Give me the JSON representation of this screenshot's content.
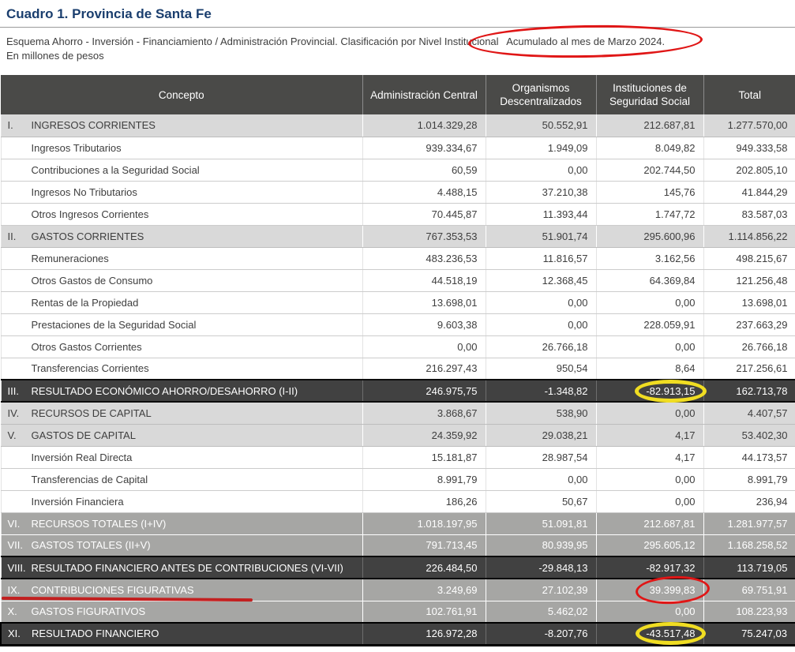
{
  "page": {
    "title": "Cuadro 1. Provincia de Santa Fe",
    "subtitle": "Esquema Ahorro - Inversión - Financiamiento / Administración Provincial. Clasificación por Nivel Institucional",
    "period": "Acumulado al mes de Marzo 2024.",
    "units": "En millones de pesos"
  },
  "table": {
    "headers": [
      "Concepto",
      "Administración Central",
      "Organismos Descentralizados",
      "Instituciones de Seguridad Social",
      "Total"
    ],
    "rows": [
      {
        "numeral": "I.",
        "label": "INGRESOS CORRIENTES",
        "style": "section",
        "values": [
          "1.014.329,28",
          "50.552,91",
          "212.687,81",
          "1.277.570,00"
        ]
      },
      {
        "numeral": "",
        "label": "Ingresos Tributarios",
        "style": "detail",
        "values": [
          "939.334,67",
          "1.949,09",
          "8.049,82",
          "949.333,58"
        ]
      },
      {
        "numeral": "",
        "label": "Contribuciones a la Seguridad Social",
        "style": "detail",
        "values": [
          "60,59",
          "0,00",
          "202.744,50",
          "202.805,10"
        ]
      },
      {
        "numeral": "",
        "label": "Ingresos No Tributarios",
        "style": "detail",
        "values": [
          "4.488,15",
          "37.210,38",
          "145,76",
          "41.844,29"
        ]
      },
      {
        "numeral": "",
        "label": "Otros Ingresos Corrientes",
        "style": "detail",
        "values": [
          "70.445,87",
          "11.393,44",
          "1.747,72",
          "83.587,03"
        ]
      },
      {
        "numeral": "II.",
        "label": "GASTOS CORRIENTES",
        "style": "section",
        "values": [
          "767.353,53",
          "51.901,74",
          "295.600,96",
          "1.114.856,22"
        ]
      },
      {
        "numeral": "",
        "label": "Remuneraciones",
        "style": "detail",
        "values": [
          "483.236,53",
          "11.816,57",
          "3.162,56",
          "498.215,67"
        ]
      },
      {
        "numeral": "",
        "label": "Otros Gastos de Consumo",
        "style": "detail",
        "values": [
          "44.518,19",
          "12.368,45",
          "64.369,84",
          "121.256,48"
        ]
      },
      {
        "numeral": "",
        "label": "Rentas de la Propiedad",
        "style": "detail",
        "values": [
          "13.698,01",
          "0,00",
          "0,00",
          "13.698,01"
        ]
      },
      {
        "numeral": "",
        "label": "Prestaciones de la Seguridad Social",
        "style": "detail",
        "values": [
          "9.603,38",
          "0,00",
          "228.059,91",
          "237.663,29"
        ]
      },
      {
        "numeral": "",
        "label": "Otros Gastos Corrientes",
        "style": "detail",
        "values": [
          "0,00",
          "26.766,18",
          "0,00",
          "26.766,18"
        ]
      },
      {
        "numeral": "",
        "label": "Transferencias Corrientes",
        "style": "detail",
        "values": [
          "216.297,43",
          "950,54",
          "8,64",
          "217.256,61"
        ]
      },
      {
        "numeral": "III.",
        "label": "RESULTADO ECONÓMICO AHORRO/DESAHORRO (I-II)",
        "style": "dark",
        "values": [
          "246.975,75",
          "-1.348,82",
          "-82.913,15",
          "162.713,78"
        ]
      },
      {
        "numeral": "IV.",
        "label": "RECURSOS DE CAPITAL",
        "style": "section",
        "values": [
          "3.868,67",
          "538,90",
          "0,00",
          "4.407,57"
        ]
      },
      {
        "numeral": "V.",
        "label": "GASTOS DE CAPITAL",
        "style": "section",
        "values": [
          "24.359,92",
          "29.038,21",
          "4,17",
          "53.402,30"
        ]
      },
      {
        "numeral": "",
        "label": "Inversión Real Directa",
        "style": "detail",
        "values": [
          "15.181,87",
          "28.987,54",
          "4,17",
          "44.173,57"
        ]
      },
      {
        "numeral": "",
        "label": "Transferencias de Capital",
        "style": "detail",
        "values": [
          "8.991,79",
          "0,00",
          "0,00",
          "8.991,79"
        ]
      },
      {
        "numeral": "",
        "label": "Inversión Financiera",
        "style": "detail",
        "values": [
          "186,26",
          "50,67",
          "0,00",
          "236,94"
        ]
      },
      {
        "numeral": "VI.",
        "label": "RECURSOS TOTALES (I+IV)",
        "style": "medium",
        "values": [
          "1.018.197,95",
          "51.091,81",
          "212.687,81",
          "1.281.977,57"
        ]
      },
      {
        "numeral": "VII.",
        "label": "GASTOS TOTALES (II+V)",
        "style": "medium",
        "values": [
          "791.713,45",
          "80.939,95",
          "295.605,12",
          "1.168.258,52"
        ]
      },
      {
        "numeral": "VIII.",
        "label": "RESULTADO FINANCIERO ANTES DE CONTRIBUCIONES (VI-VII)",
        "style": "dark",
        "values": [
          "226.484,50",
          "-29.848,13",
          "-82.917,32",
          "113.719,05"
        ]
      },
      {
        "numeral": "IX.",
        "label": "CONTRIBUCIONES FIGURATIVAS",
        "style": "medium",
        "values": [
          "3.249,69",
          "27.102,39",
          "39.399,83",
          "69.751,91"
        ]
      },
      {
        "numeral": "X.",
        "label": "GASTOS FIGURATIVOS",
        "style": "medium",
        "values": [
          "102.761,91",
          "5.462,02",
          "0,00",
          "108.223,93"
        ]
      },
      {
        "numeral": "XI.",
        "label": "RESULTADO FINANCIERO",
        "style": "darkfinal",
        "values": [
          "126.972,28",
          "-8.207,76",
          "-43.517,48",
          "75.247,03"
        ]
      }
    ]
  },
  "annotations": {
    "red_color": "#e01616",
    "yellow_color": "#f0dd22",
    "underline_color": "#c22020",
    "items": [
      {
        "type": "red-ellipse",
        "target_text": "Acumulado al mes de Marzo 2024."
      },
      {
        "type": "yellow-ellipse",
        "target_text": "-82.913,15"
      },
      {
        "type": "red-ellipse",
        "target_text": "39.399,83"
      },
      {
        "type": "yellow-ellipse",
        "target_text": "-43.517,48"
      },
      {
        "type": "red-underline",
        "target_text": "IX. CONTRIBUCIONES FIGURATIVAS"
      }
    ]
  }
}
